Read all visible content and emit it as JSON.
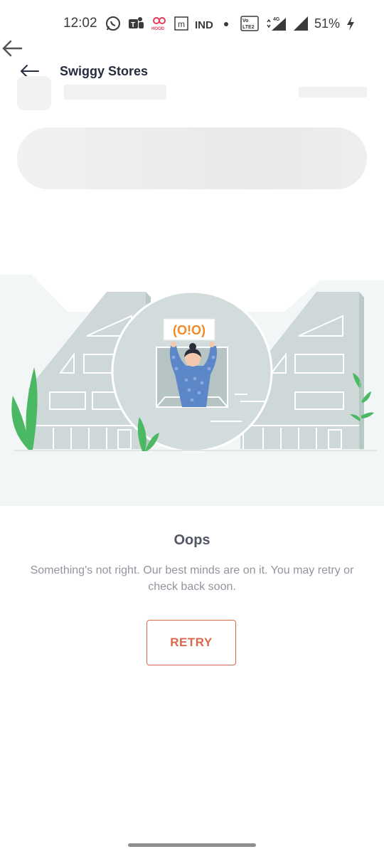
{
  "status_bar": {
    "time": "12:02",
    "icons": [
      "whatsapp-icon",
      "teams-icon",
      "hood-icon",
      "m-icon",
      "ind-icon",
      "dot-icon"
    ],
    "hood_text": "HOOD",
    "m_text": "m",
    "ind_text": "IND",
    "volte_text": "Vo LTE 2",
    "network_text": "4G",
    "battery": "51%"
  },
  "header": {
    "title": "Swiggy Stores"
  },
  "illustration": {
    "sign_text": "(O!O)"
  },
  "error": {
    "title": "Oops",
    "message": "Something's not right. Our best minds are on it. You may retry or check back soon.",
    "retry_label": "RETRY"
  },
  "colors": {
    "accent": "#d9694b",
    "title": "#282c3f",
    "muted": "#93959f",
    "building": "#cfd8d8",
    "plant": "#4bb863",
    "person": "#5b86c8"
  }
}
